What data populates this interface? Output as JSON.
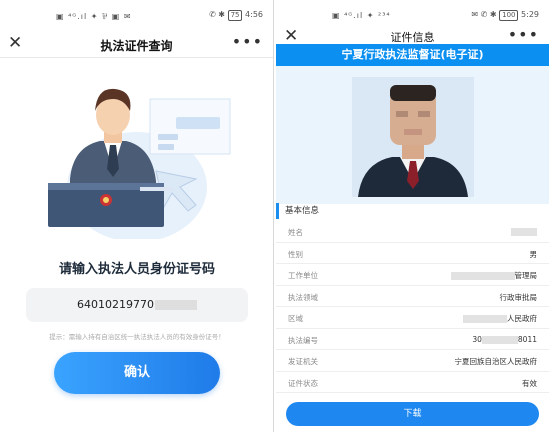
{
  "left": {
    "status": {
      "icons_left": "▣ ⁴ᴳ.ıl ✦ ⅌ ▣ ✉",
      "icons_right": "✆ ✱ ",
      "battery": "75",
      "time": "4:56"
    },
    "nav": {
      "close": "✕",
      "title": "执法证件查询",
      "more": "•••"
    },
    "prompt": "请输入执法人员身份证号码",
    "id_value": "64010219770",
    "hint": "提示：需输入持有自治区统一执法执法人员的有效身份证号！",
    "confirm_label": "确认"
  },
  "right": {
    "status": {
      "icons_left": "▣ ⁴ᴳ.ıl ✦ ²³⁴",
      "icons_right": "✉ ✆ ✱ ",
      "battery": "100",
      "time": "5:29"
    },
    "nav": {
      "close": "✕",
      "title": "证件信息",
      "more": "•••"
    },
    "banner": "宁夏行政执法监督证(电子证)",
    "section_title": "基本信息",
    "rows": [
      {
        "label": "姓名",
        "value": ""
      },
      {
        "label": "性别",
        "value": "男"
      },
      {
        "label": "工作单位",
        "value": "管理局"
      },
      {
        "label": "执法领域",
        "value": "行政审批局"
      },
      {
        "label": "区域",
        "value": "人民政府"
      },
      {
        "label": "执法编号",
        "value_prefix": "30",
        "value": "8011"
      },
      {
        "label": "发证机关",
        "value": "宁夏回族自治区人民政府"
      },
      {
        "label": "证件状态",
        "value": "有效"
      }
    ],
    "download_label": "下载"
  },
  "colors": {
    "accent": "#1e88f0",
    "banner": "#0b8ff0",
    "photo_bg": "#eaf4fc"
  }
}
